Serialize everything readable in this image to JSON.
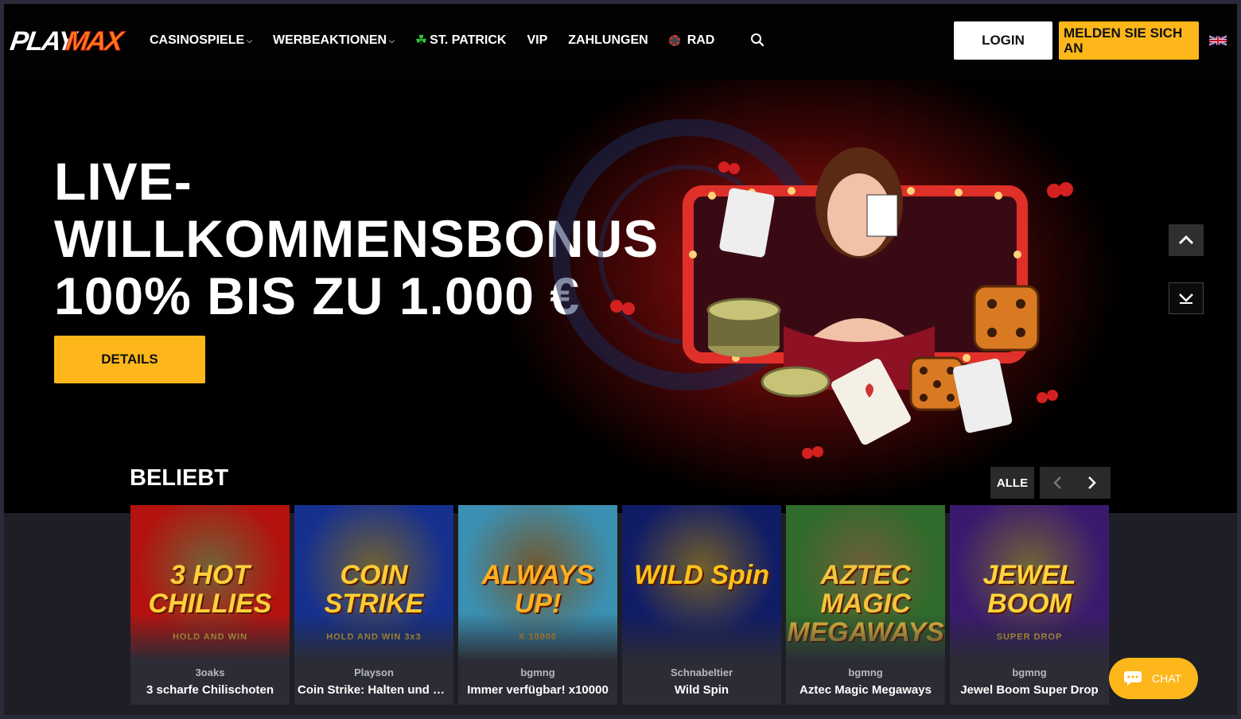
{
  "brand": {
    "logo_text_white": "PLAY",
    "logo_text_orange": "MAX",
    "accent_color": "#fdb71a"
  },
  "nav": {
    "items": [
      {
        "label": "CASINOSPIELE",
        "icon": "chevron-down-icon"
      },
      {
        "label": "WERBEAKTIONEN",
        "icon": "chevron-down-icon"
      },
      {
        "label": "ST. PATRICK",
        "icon": "shamrock-icon"
      },
      {
        "label": "VIP"
      },
      {
        "label": "ZAHLUNGEN"
      },
      {
        "label": "RAD",
        "icon": "wheel-icon"
      }
    ],
    "search_icon": "search-icon"
  },
  "auth": {
    "login_label": "LOGIN",
    "signup_label": "MELDEN SIE SICH AN",
    "language_icon": "uk-flag-icon"
  },
  "hero": {
    "title_line1": "LIVE-",
    "title_line2": "WILLKOMMENSBONUS",
    "title_line3": "100% BIS ZU 1.000 €",
    "cta_label": "DETAILS"
  },
  "popular": {
    "title": "BELIEBT",
    "all_label": "ALLE",
    "games": [
      {
        "provider": "3oaks",
        "name": "3 scharfe Chilischoten",
        "art_title": "3 HOT CHILLIES",
        "art_sub": "HOLD AND WIN",
        "bg": "#b3120f",
        "fg": "#ffd03a"
      },
      {
        "provider": "Playson",
        "name": "Coin Strike: Halten und gewinnen",
        "art_title": "COIN STRIKE",
        "art_sub": "HOLD AND WIN 3x3",
        "bg": "#15308f",
        "fg": "#ffcc33"
      },
      {
        "provider": "bgmng",
        "name": "Immer verfügbar! x10000",
        "art_title": "ALWAYS UP!",
        "art_sub": "X 10000",
        "bg": "#3b8fb0",
        "fg": "#ffb020"
      },
      {
        "provider": "Schnabeltier",
        "name": "Wild Spin",
        "art_title": "WILD Spin",
        "art_sub": "",
        "bg": "#101c66",
        "fg": "#ffc21a"
      },
      {
        "provider": "bgmng",
        "name": "Aztec Magic Megaways",
        "art_title": "AZTEC MAGIC MEGAWAYS",
        "art_sub": "",
        "bg": "#2f6b2a",
        "fg": "#f2c43c"
      },
      {
        "provider": "bgmng",
        "name": "Jewel Boom Super Drop",
        "art_title": "JEWEL BOOM",
        "art_sub": "SUPER DROP",
        "bg": "#3a1a6e",
        "fg": "#ffd43a"
      }
    ]
  },
  "chat": {
    "label": "CHAT"
  }
}
